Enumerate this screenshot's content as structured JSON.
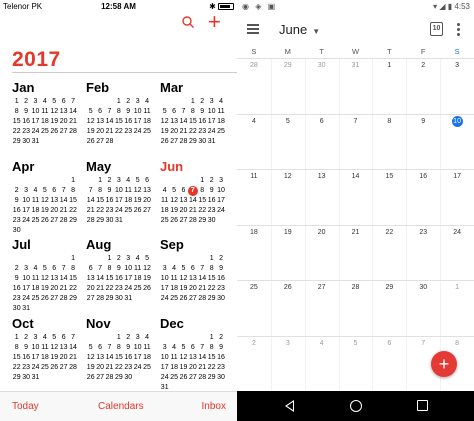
{
  "ios": {
    "status": {
      "carrier": "Telenor PK",
      "time": "12:58 AM"
    },
    "year": "2017",
    "today_month": "Jun",
    "today_day": "7",
    "months": [
      {
        "name": "Jan",
        "weeks": [
          [
            "1",
            "2",
            "3",
            "4",
            "5",
            "6",
            "7"
          ],
          [
            "8",
            "9",
            "10",
            "11",
            "12",
            "13",
            "14"
          ],
          [
            "15",
            "16",
            "17",
            "18",
            "19",
            "20",
            "21"
          ],
          [
            "22",
            "23",
            "24",
            "25",
            "26",
            "27",
            "28"
          ],
          [
            "29",
            "30",
            "31",
            "",
            "",
            "",
            ""
          ]
        ]
      },
      {
        "name": "Feb",
        "weeks": [
          [
            "",
            "",
            "",
            "1",
            "2",
            "3",
            "4"
          ],
          [
            "5",
            "6",
            "7",
            "8",
            "9",
            "10",
            "11"
          ],
          [
            "12",
            "13",
            "14",
            "15",
            "16",
            "17",
            "18"
          ],
          [
            "19",
            "20",
            "21",
            "22",
            "23",
            "24",
            "25"
          ],
          [
            "26",
            "27",
            "28",
            "",
            "",
            "",
            ""
          ]
        ]
      },
      {
        "name": "Mar",
        "weeks": [
          [
            "",
            "",
            "",
            "1",
            "2",
            "3",
            "4"
          ],
          [
            "5",
            "6",
            "7",
            "8",
            "9",
            "10",
            "11"
          ],
          [
            "12",
            "13",
            "14",
            "15",
            "16",
            "17",
            "18"
          ],
          [
            "19",
            "20",
            "21",
            "22",
            "23",
            "24",
            "25"
          ],
          [
            "26",
            "27",
            "28",
            "29",
            "30",
            "31",
            ""
          ]
        ]
      },
      {
        "name": "Apr",
        "weeks": [
          [
            "",
            "",
            "",
            "",
            "",
            "",
            "1"
          ],
          [
            "2",
            "3",
            "4",
            "5",
            "6",
            "7",
            "8"
          ],
          [
            "9",
            "10",
            "11",
            "12",
            "13",
            "14",
            "15"
          ],
          [
            "16",
            "17",
            "18",
            "19",
            "20",
            "21",
            "22"
          ],
          [
            "23",
            "24",
            "25",
            "26",
            "27",
            "28",
            "29"
          ],
          [
            "30",
            "",
            "",
            "",
            "",
            "",
            ""
          ]
        ]
      },
      {
        "name": "May",
        "weeks": [
          [
            "",
            "1",
            "2",
            "3",
            "4",
            "5",
            "6"
          ],
          [
            "7",
            "8",
            "9",
            "10",
            "11",
            "12",
            "13"
          ],
          [
            "14",
            "15",
            "16",
            "17",
            "18",
            "19",
            "20"
          ],
          [
            "21",
            "22",
            "23",
            "24",
            "25",
            "26",
            "27"
          ],
          [
            "28",
            "29",
            "30",
            "31",
            "",
            "",
            ""
          ]
        ]
      },
      {
        "name": "Jun",
        "weeks": [
          [
            "",
            "",
            "",
            "",
            "1",
            "2",
            "3"
          ],
          [
            "4",
            "5",
            "6",
            "7",
            "8",
            "9",
            "10"
          ],
          [
            "11",
            "12",
            "13",
            "14",
            "15",
            "16",
            "17"
          ],
          [
            "18",
            "19",
            "20",
            "21",
            "22",
            "23",
            "24"
          ],
          [
            "25",
            "26",
            "27",
            "28",
            "29",
            "30",
            ""
          ]
        ]
      },
      {
        "name": "Jul",
        "weeks": [
          [
            "",
            "",
            "",
            "",
            "",
            "",
            "1"
          ],
          [
            "2",
            "3",
            "4",
            "5",
            "6",
            "7",
            "8"
          ],
          [
            "9",
            "10",
            "11",
            "12",
            "13",
            "14",
            "15"
          ],
          [
            "16",
            "17",
            "18",
            "19",
            "20",
            "21",
            "22"
          ],
          [
            "23",
            "24",
            "25",
            "26",
            "27",
            "28",
            "29"
          ],
          [
            "30",
            "31",
            "",
            "",
            "",
            "",
            ""
          ]
        ]
      },
      {
        "name": "Aug",
        "weeks": [
          [
            "",
            "",
            "1",
            "2",
            "3",
            "4",
            "5"
          ],
          [
            "6",
            "7",
            "8",
            "9",
            "10",
            "11",
            "12"
          ],
          [
            "13",
            "14",
            "15",
            "16",
            "17",
            "18",
            "19"
          ],
          [
            "20",
            "21",
            "22",
            "23",
            "24",
            "25",
            "26"
          ],
          [
            "27",
            "28",
            "29",
            "30",
            "31",
            "",
            ""
          ]
        ]
      },
      {
        "name": "Sep",
        "weeks": [
          [
            "",
            "",
            "",
            "",
            "",
            "1",
            "2"
          ],
          [
            "3",
            "4",
            "5",
            "6",
            "7",
            "8",
            "9"
          ],
          [
            "10",
            "11",
            "12",
            "13",
            "14",
            "15",
            "16"
          ],
          [
            "17",
            "18",
            "19",
            "20",
            "21",
            "22",
            "23"
          ],
          [
            "24",
            "25",
            "26",
            "27",
            "28",
            "29",
            "30"
          ]
        ]
      },
      {
        "name": "Oct",
        "weeks": [
          [
            "1",
            "2",
            "3",
            "4",
            "5",
            "6",
            "7"
          ],
          [
            "8",
            "9",
            "10",
            "11",
            "12",
            "13",
            "14"
          ],
          [
            "15",
            "16",
            "17",
            "18",
            "19",
            "20",
            "21"
          ],
          [
            "22",
            "23",
            "24",
            "25",
            "26",
            "27",
            "28"
          ],
          [
            "29",
            "30",
            "31",
            "",
            "",
            "",
            ""
          ]
        ]
      },
      {
        "name": "Nov",
        "weeks": [
          [
            "",
            "",
            "",
            "1",
            "2",
            "3",
            "4"
          ],
          [
            "5",
            "6",
            "7",
            "8",
            "9",
            "10",
            "11"
          ],
          [
            "12",
            "13",
            "14",
            "15",
            "16",
            "17",
            "18"
          ],
          [
            "19",
            "20",
            "21",
            "22",
            "23",
            "24",
            "25"
          ],
          [
            "26",
            "27",
            "28",
            "29",
            "30",
            "",
            ""
          ]
        ]
      },
      {
        "name": "Dec",
        "weeks": [
          [
            "",
            "",
            "",
            "",
            "",
            "1",
            "2"
          ],
          [
            "3",
            "4",
            "5",
            "6",
            "7",
            "8",
            "9"
          ],
          [
            "10",
            "11",
            "12",
            "13",
            "14",
            "15",
            "16"
          ],
          [
            "17",
            "18",
            "19",
            "20",
            "21",
            "22",
            "23"
          ],
          [
            "24",
            "25",
            "26",
            "27",
            "28",
            "29",
            "30"
          ],
          [
            "31",
            "",
            "",
            "",
            "",
            "",
            ""
          ]
        ]
      }
    ],
    "tabbar": {
      "today": "Today",
      "calendars": "Calendars",
      "inbox": "Inbox"
    },
    "accent_color": "#e5372b"
  },
  "android": {
    "status": {
      "time": "4:53"
    },
    "title": "June",
    "today_icon_number": "10",
    "weekdays": [
      "S",
      "M",
      "T",
      "W",
      "T",
      "F",
      "S"
    ],
    "today_weekday_index": 6,
    "today_date": "10",
    "weeks": [
      [
        {
          "d": "28",
          "dim": true
        },
        {
          "d": "29",
          "dim": true
        },
        {
          "d": "30",
          "dim": true
        },
        {
          "d": "31",
          "dim": true
        },
        {
          "d": "1"
        },
        {
          "d": "2"
        },
        {
          "d": "3"
        }
      ],
      [
        {
          "d": "4"
        },
        {
          "d": "5"
        },
        {
          "d": "6"
        },
        {
          "d": "7"
        },
        {
          "d": "8"
        },
        {
          "d": "9"
        },
        {
          "d": "10",
          "today": true
        }
      ],
      [
        {
          "d": "11"
        },
        {
          "d": "12"
        },
        {
          "d": "13"
        },
        {
          "d": "14"
        },
        {
          "d": "15"
        },
        {
          "d": "16"
        },
        {
          "d": "17"
        }
      ],
      [
        {
          "d": "18"
        },
        {
          "d": "19"
        },
        {
          "d": "20"
        },
        {
          "d": "21"
        },
        {
          "d": "22"
        },
        {
          "d": "23"
        },
        {
          "d": "24"
        }
      ],
      [
        {
          "d": "25"
        },
        {
          "d": "26"
        },
        {
          "d": "27"
        },
        {
          "d": "28"
        },
        {
          "d": "29"
        },
        {
          "d": "30"
        },
        {
          "d": "1",
          "dim": true
        }
      ],
      [
        {
          "d": "2",
          "dim": true
        },
        {
          "d": "3",
          "dim": true
        },
        {
          "d": "4",
          "dim": true
        },
        {
          "d": "5",
          "dim": true
        },
        {
          "d": "6",
          "dim": true
        },
        {
          "d": "7",
          "dim": true
        },
        {
          "d": "8",
          "dim": true
        }
      ]
    ],
    "fab_symbol": "+",
    "accent_color": "#1a73e8",
    "fab_color": "#e53935"
  }
}
